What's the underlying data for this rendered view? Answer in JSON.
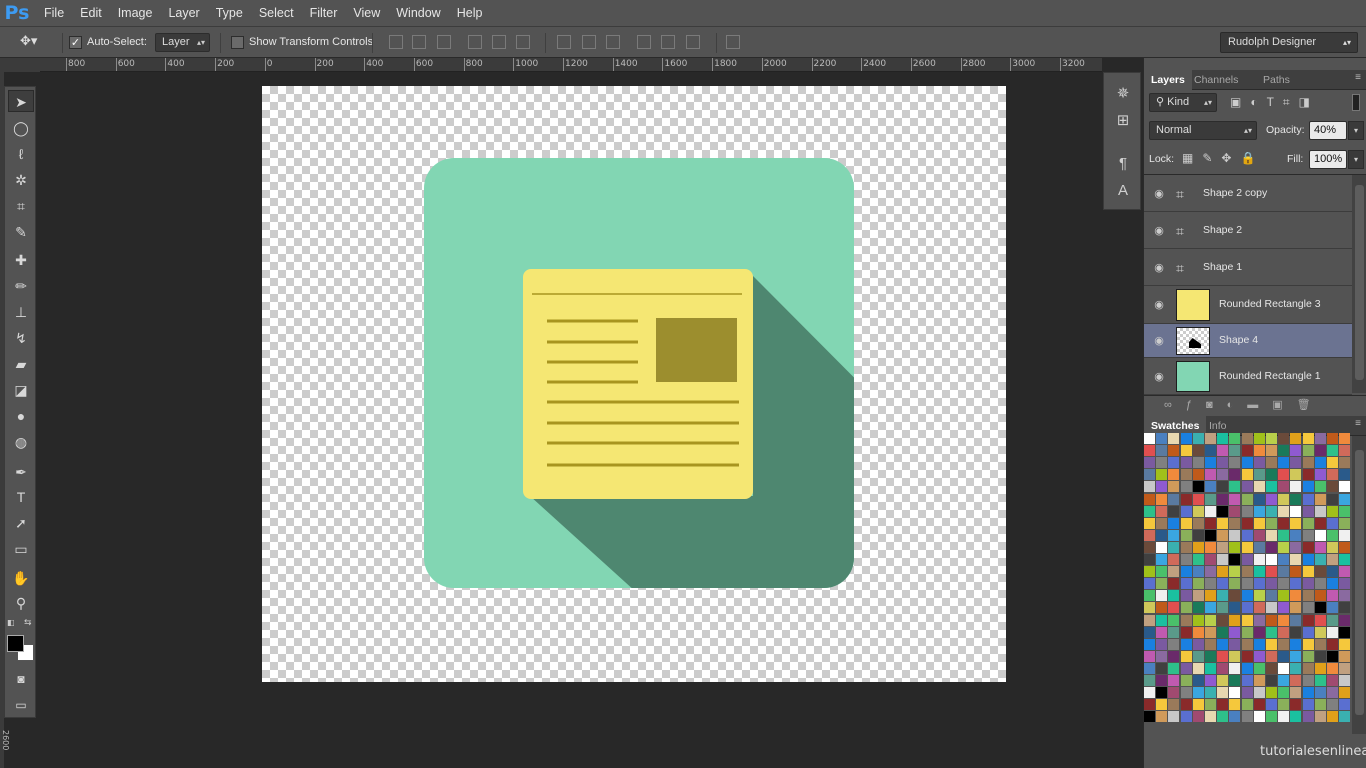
{
  "app": {
    "logo": "Ps"
  },
  "menu": [
    "File",
    "Edit",
    "Image",
    "Layer",
    "Type",
    "Select",
    "Filter",
    "View",
    "Window",
    "Help"
  ],
  "options": {
    "auto_select_label": "Auto-Select:",
    "auto_select_checked": true,
    "auto_select_target": "Layer",
    "show_transform_label": "Show Transform Controls",
    "show_transform_checked": false
  },
  "workspace": "Rudolph Designer",
  "ruler_top": [
    "800",
    "600",
    "400",
    "200",
    "0",
    "200",
    "400",
    "600",
    "800",
    "1000",
    "1200",
    "1400",
    "1600",
    "1800",
    "2000",
    "2200",
    "2400",
    "2600",
    "2800",
    "3000",
    "3200"
  ],
  "ruler_left": "2600",
  "tools": [
    "move-tool",
    "marquee-tool",
    "lasso-tool",
    "magic-wand-tool",
    "crop-tool",
    "eyedropper-tool",
    "healing-tool",
    "brush-tool",
    "stamp-tool",
    "history-brush-tool",
    "eraser-tool",
    "paint-bucket-tool",
    "blur-tool",
    "dodge-tool",
    "pen-tool",
    "type-tool",
    "path-select-tool",
    "rectangle-tool",
    "hand-tool",
    "zoom-tool"
  ],
  "colors": {
    "foreground": "#000000",
    "background": "#ffffff",
    "icon_bg": "#82d6b3",
    "shadow": "#4e8770",
    "note": "#f5e773",
    "note_lines": "#a8951f",
    "note_image": "#9c8e2e",
    "selection": "#6b7391"
  },
  "layers_panel": {
    "tabs": [
      "Layers",
      "Channels",
      "Paths"
    ],
    "filter_kind": "Kind",
    "blend_mode": "Normal",
    "opacity_label": "Opacity:",
    "opacity": "40%",
    "lock_label": "Lock:",
    "fill_label": "Fill:",
    "fill": "100%",
    "layers": [
      {
        "name": "Shape 2 copy",
        "type": "shape",
        "selected": false
      },
      {
        "name": "Shape 2",
        "type": "shape",
        "selected": false
      },
      {
        "name": "Shape 1",
        "type": "shape",
        "selected": false
      },
      {
        "name": "Rounded Rectangle 3",
        "type": "yellow",
        "selected": false
      },
      {
        "name": "Shape 4",
        "type": "mask",
        "selected": true
      },
      {
        "name": "Rounded Rectangle 1",
        "type": "green",
        "selected": false
      }
    ]
  },
  "swatches_panel": {
    "tabs": [
      "Swatches",
      "Info"
    ]
  },
  "watermark": "tutorialesenlinea.es"
}
